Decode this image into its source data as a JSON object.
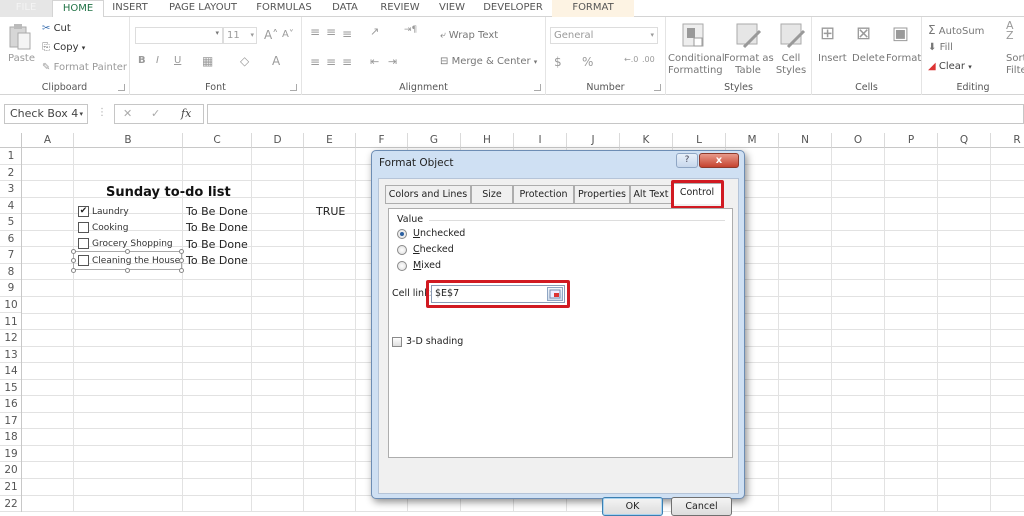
{
  "ribbon_tabs": [
    "FILE",
    "HOME",
    "INSERT",
    "PAGE LAYOUT",
    "FORMULAS",
    "DATA",
    "REVIEW",
    "VIEW",
    "DEVELOPER",
    "FORMAT"
  ],
  "active_tab": "HOME",
  "ribbon": {
    "clipboard": {
      "label": "Clipboard",
      "paste": "Paste",
      "cut": "Cut",
      "copy": "Copy",
      "format_painter": "Format Painter"
    },
    "font": {
      "label": "Font",
      "font_name": "",
      "font_size": "11",
      "bold": "B",
      "italic": "I",
      "underline": "U",
      "font_color": "A"
    },
    "alignment": {
      "label": "Alignment",
      "wrap_text": "Wrap Text",
      "merge_center": "Merge & Center"
    },
    "number": {
      "label": "Number",
      "format": "General",
      "currency": "$",
      "percent": "%"
    },
    "styles": {
      "label": "Styles",
      "conditional_formatting": [
        "Conditional",
        "Formatting"
      ],
      "format_as_table": [
        "Format as",
        "Table"
      ],
      "cell_styles": [
        "Cell",
        "Styles"
      ]
    },
    "cells": {
      "label": "Cells",
      "insert": "Insert",
      "delete": "Delete",
      "format": "Format"
    },
    "editing": {
      "label": "Editing",
      "autosum": "AutoSum",
      "fill": "Fill",
      "clear": "Clear",
      "sort_filter": [
        "Sort",
        "Filte"
      ]
    }
  },
  "formula_bar": {
    "name_box": "Check Box 4",
    "fx": "fx",
    "formula": ""
  },
  "columns": [
    "A",
    "B",
    "C",
    "D",
    "E",
    "F",
    "G",
    "H",
    "I",
    "J",
    "K",
    "L",
    "M",
    "N",
    "O",
    "P",
    "Q",
    "R"
  ],
  "rows": [
    "1",
    "2",
    "3",
    "4",
    "5",
    "6",
    "7",
    "8",
    "9",
    "10",
    "11",
    "12",
    "13",
    "14",
    "15",
    "16",
    "17",
    "18",
    "19",
    "20",
    "21",
    "22"
  ],
  "sheet": {
    "title": "Sunday to-do list",
    "tasks": [
      {
        "label": "Laundry",
        "checked": true,
        "status": "To Be Done"
      },
      {
        "label": "Cooking",
        "checked": false,
        "status": "To Be Done"
      },
      {
        "label": "Grocery Shopping",
        "checked": false,
        "status": "To Be Done"
      },
      {
        "label": "Cleaning the House",
        "checked": false,
        "status": "To Be Done"
      }
    ],
    "e4_value": "TRUE"
  },
  "dialog": {
    "title": "Format Object",
    "help": "?",
    "close": "x",
    "tabs": [
      "Colors and Lines",
      "Size",
      "Protection",
      "Properties",
      "Alt Text",
      "Control"
    ],
    "active_tab": "Control",
    "value_legend": "Value",
    "options": [
      {
        "label": "Unchecked",
        "accel": "U",
        "rest": "nchecked",
        "selected": true
      },
      {
        "label": "Checked",
        "accel": "C",
        "rest": "hecked",
        "selected": false
      },
      {
        "label": "Mixed",
        "accel": "M",
        "rest": "ixed",
        "selected": false
      }
    ],
    "cell_link_label": "Cell link:",
    "cell_link_value": "$E$7",
    "shading_label": "3-D shading",
    "shading_checked": false,
    "ok": "OK",
    "cancel": "Cancel"
  },
  "colors": {
    "accent": "#217346",
    "highlight": "#d11a22",
    "format_tab": "#fdf3e3"
  }
}
